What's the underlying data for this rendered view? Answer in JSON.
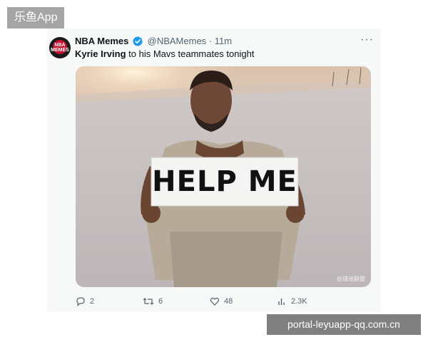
{
  "overlay_app_label": "乐鱼App",
  "overlay_url": "portal-leyuapp-qq.com.cn",
  "tweet": {
    "avatar_text_top": "NBA",
    "avatar_text_bottom": "MEMES",
    "author_name": "NBA Memes",
    "handle": "@NBAMemes",
    "separator": "·",
    "time": "11m",
    "more": "···",
    "text_bold": "Kyrie Irving",
    "text_rest": " to his Mavs teammates tonight",
    "image": {
      "sign_text": "HELP ME",
      "watermark": "@球迷联盟"
    },
    "actions": {
      "replies": "2",
      "reposts": "6",
      "likes": "48",
      "views": "2.3K"
    }
  },
  "colors": {
    "verified": "#1d9bf0",
    "muted": "#536471",
    "text": "#0f1419",
    "card_bg": "#f7f9f9"
  }
}
